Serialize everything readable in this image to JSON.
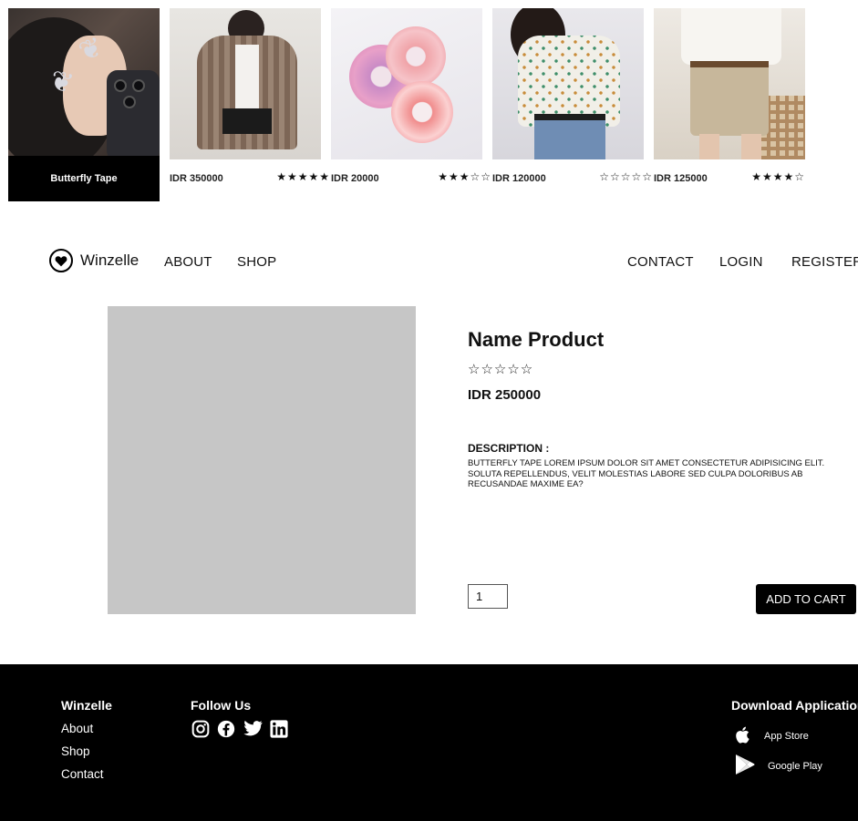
{
  "products": [
    {
      "label": "Butterfly Tape"
    },
    {
      "price": "IDR 350000",
      "stars": "★★★★★",
      "rating": 5
    },
    {
      "price": "IDR 20000",
      "stars": "★★★☆☆",
      "rating": 3
    },
    {
      "price": "IDR 120000",
      "stars": "☆☆☆☆☆",
      "rating": 0
    },
    {
      "price": "IDR 125000",
      "stars": "★★★★☆",
      "rating": 4
    }
  ],
  "nav": {
    "brand": "Winzelle",
    "about": "ABOUT",
    "shop": "SHOP",
    "contact": "CONTACT",
    "login": "LOGIN",
    "register": "REGISTER"
  },
  "product": {
    "title": "Name Product",
    "stars": "☆☆☆☆☆",
    "rating": 0,
    "price": "IDR 250000",
    "description_heading": "DESCRIPTION :",
    "description": "BUTTERFLY TAPE LOREM IPSUM DOLOR SIT AMET CONSECTETUR ADIPISICING ELIT. SOLUTA REPELLENDUS, VELIT MOLESTIAS LABORE SED CULPA DOLORIBUS AB RECUSANDAE MAXIME EA?",
    "quantity": "1",
    "add_to_cart": "ADD TO CART"
  },
  "footer": {
    "brand": "Winzelle",
    "links": [
      "About",
      "Shop",
      "Contact"
    ],
    "follow_title": "Follow Us",
    "social_icons": [
      "instagram-icon",
      "facebook-icon",
      "twitter-icon",
      "linkedin-icon"
    ],
    "download_title": "Download Application",
    "app_store": "App Store",
    "google_play": "Google Play"
  },
  "colors": {
    "footer_bg": "#000000",
    "image_placeholder": "#c6c6c6",
    "button_bg": "#000000"
  }
}
